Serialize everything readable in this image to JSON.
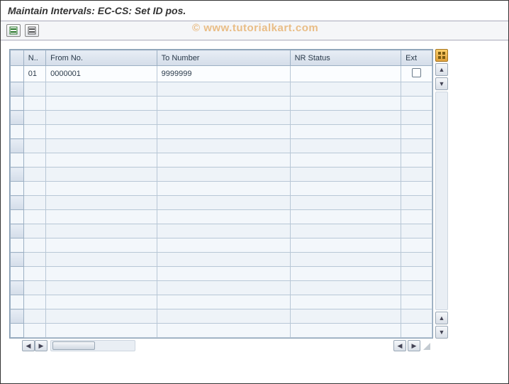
{
  "title": "Maintain Intervals: EC-CS: Set ID pos.",
  "watermark": "© www.tutorialkart.com",
  "toolbar": {
    "insert_label": "Insert Line",
    "delete_label": "Delete Line"
  },
  "table": {
    "columns": {
      "no": "N..",
      "from_no": "From No.",
      "to_no": "To Number",
      "nr_status": "NR Status",
      "ext": "Ext"
    },
    "rows": [
      {
        "no": "01",
        "from_no": "0000001",
        "to_no": "9999999",
        "nr_status": "",
        "ext": false
      }
    ],
    "blank_row_count": 18
  },
  "scroll": {
    "up": "▲",
    "down": "▼",
    "left": "◀",
    "right": "▶"
  }
}
